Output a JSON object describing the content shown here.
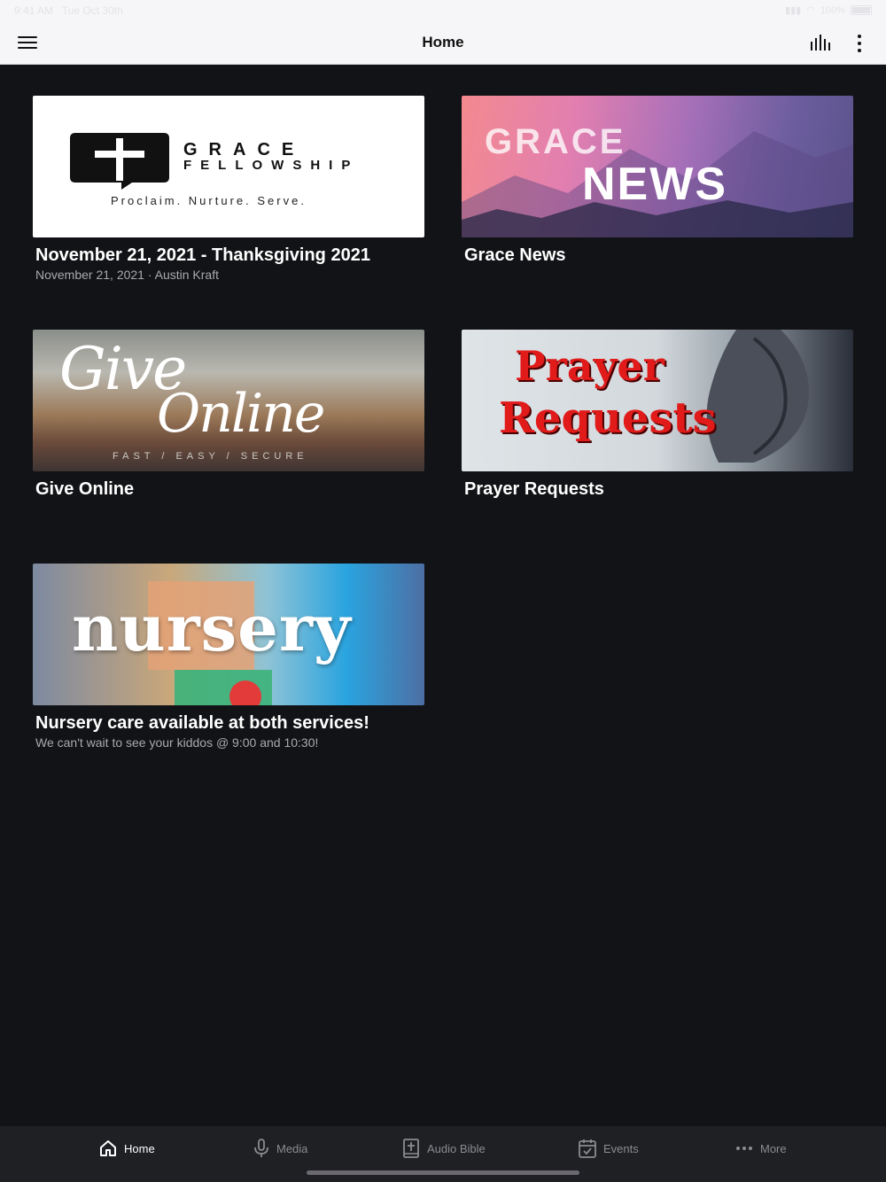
{
  "status_bar": {
    "time": "9:41 AM",
    "date": "Tue Oct 30th",
    "battery": "100%"
  },
  "nav": {
    "title": "Home"
  },
  "cards": [
    {
      "title": "November 21, 2021 - Thanksgiving 2021",
      "subtitle": "November 21, 2021 · Austin Kraft",
      "image_text": {
        "line1": "GRACE",
        "line2": "FELLOWSHIP",
        "tagline": "Proclaim. Nurture. Serve."
      }
    },
    {
      "title": "Grace News",
      "subtitle": "",
      "image_text": {
        "line1": "GRACE",
        "line2": "NEWS"
      }
    },
    {
      "title": "Give Online",
      "subtitle": "",
      "image_text": {
        "line1": "Give",
        "line2": "Online",
        "tagline": "FAST / EASY / SECURE"
      }
    },
    {
      "title": "Prayer Requests",
      "subtitle": "",
      "image_text": {
        "line1": "Prayer",
        "line2": "Requests"
      }
    },
    {
      "title": "Nursery care available at both services!",
      "subtitle": "We can't wait to see your kiddos @ 9:00 and 10:30!",
      "image_text": {
        "line1": "nursery"
      }
    }
  ],
  "tabs": [
    {
      "label": "Home",
      "icon": "home-icon",
      "active": true
    },
    {
      "label": "Media",
      "icon": "microphone-icon",
      "active": false
    },
    {
      "label": "Audio Bible",
      "icon": "bible-icon",
      "active": false
    },
    {
      "label": "Events",
      "icon": "calendar-icon",
      "active": false
    },
    {
      "label": "More",
      "icon": "more-horizontal-icon",
      "active": false
    }
  ],
  "colors": {
    "background": "#121316",
    "nav_bar": "#f6f6f8",
    "tab_bar": "#1f2024",
    "tab_active": "#ffffff",
    "tab_inactive": "#8b8b90"
  }
}
